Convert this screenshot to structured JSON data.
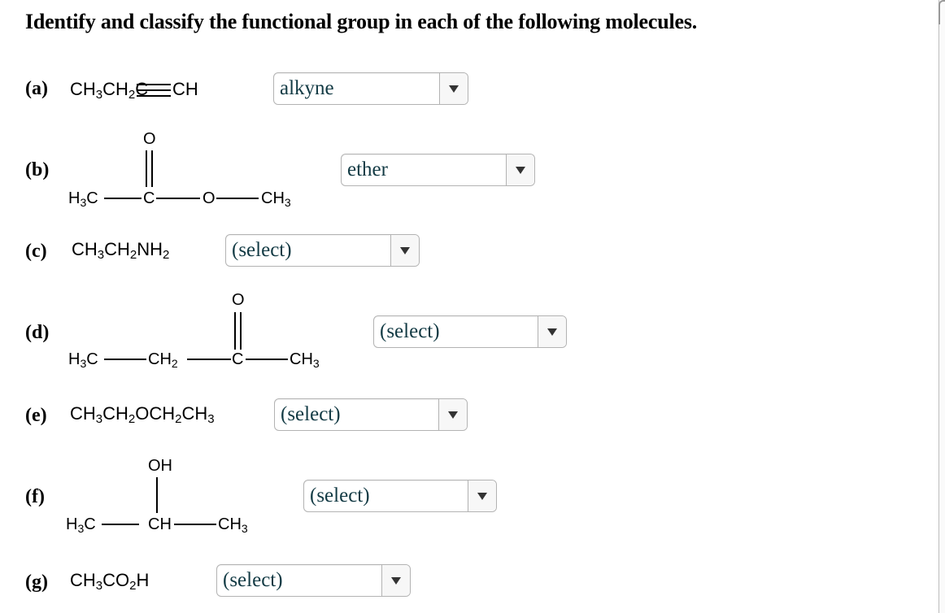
{
  "title": "Identify and classify the functional group in each of the following molecules.",
  "questions": [
    {
      "label": "(a)",
      "formula_parts": {
        "p1": "CH",
        "s1": "3",
        "p2": "CH",
        "s2": "2",
        "p3": "C",
        "p4": "CH"
      },
      "bond": "triple",
      "selected": "alkyne"
    },
    {
      "label": "(b)",
      "atoms": {
        "o_top": "O",
        "h3c": "H",
        "h3c_sub": "3",
        "h3c_c": "C",
        "c": "C",
        "o": "O",
        "ch3": "CH",
        "ch3_sub": "3"
      },
      "selected": "ether"
    },
    {
      "label": "(c)",
      "formula_parts": {
        "p1": "CH",
        "s1": "3",
        "p2": "CH",
        "s2": "2",
        "p3": "NH",
        "s3": "2"
      },
      "selected": "(select)"
    },
    {
      "label": "(d)",
      "atoms": {
        "o_top": "O",
        "h3c": "H",
        "h3c_sub": "3",
        "h3c_c": "C",
        "ch2": "CH",
        "ch2_sub": "2",
        "c": "C",
        "ch3": "CH",
        "ch3_sub": "3"
      },
      "selected": "(select)"
    },
    {
      "label": "(e)",
      "formula_parts": {
        "p1": "CH",
        "s1": "3",
        "p2": "CH",
        "s2": "2",
        "p3": "OCH",
        "s3": "2",
        "p4": "CH",
        "s4": "3"
      },
      "selected": "(select)"
    },
    {
      "label": "(f)",
      "atoms": {
        "oh": "OH",
        "h3c": "H",
        "h3c_sub": "3",
        "h3c_c": "C",
        "ch": "CH",
        "ch3": "CH",
        "ch3_sub": "3"
      },
      "selected": "(select)"
    },
    {
      "label": "(g)",
      "formula_parts": {
        "p1": "CH",
        "s1": "3",
        "p2": "CO",
        "s2": "2",
        "p3": "H"
      },
      "selected": "(select)"
    }
  ],
  "icons": {
    "dropdown": "triangle-down-icon"
  }
}
